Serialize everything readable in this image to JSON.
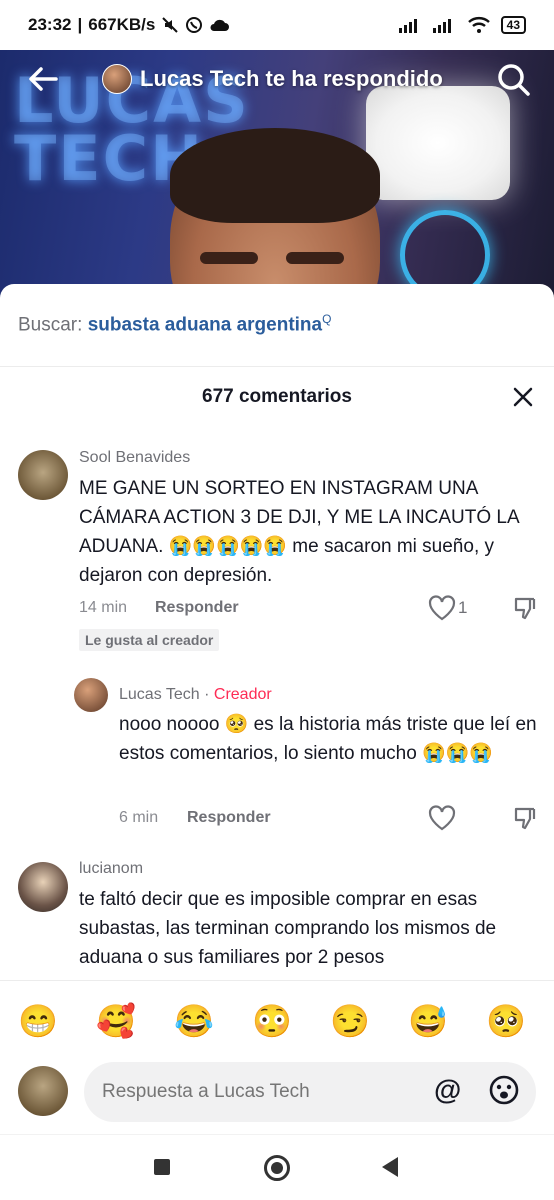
{
  "status_bar": {
    "time": "23:32",
    "net_speed": "667KB/s",
    "battery": "43"
  },
  "header": {
    "title": "Lucas Tech te ha respondido",
    "video_overlay_text": [
      "LUCAS",
      "TECH"
    ]
  },
  "search": {
    "prefix": "Buscar:",
    "query": "subasta aduana argentina",
    "mini_icon": "Q"
  },
  "comments_panel": {
    "count_label": "677 comentarios"
  },
  "comments": [
    {
      "author": "Sool Benavides",
      "text": "ME GANE UN SORTEO EN INSTAGRAM UNA CÁMARA ACTION 3 DE DJI, Y ME LA INCAUTÓ LA ADUANA. 😭😭😭😭😭 me sacaron mi sueño, y dejaron con depresión.",
      "time": "14 min",
      "reply_label": "Responder",
      "likes": "1",
      "creator_liked": "Le gusta al creador"
    },
    {
      "author": "Lucas Tech",
      "separator": "·",
      "badge": "Creador",
      "text": "nooo noooo 🥺 es la historia más triste que leí en estos comentarios, lo siento mucho 😭😭😭",
      "time": "6 min",
      "reply_label": "Responder"
    },
    {
      "author": "lucianom",
      "text": "te faltó decir que es imposible comprar en esas subastas, las terminan comprando los mismos de aduana o sus familiares por 2 pesos"
    }
  ],
  "emoji_bar": [
    "😁",
    "🥰",
    "😂",
    "😳",
    "😏",
    "😅",
    "🥺"
  ],
  "reply_input": {
    "placeholder": "Respuesta a Lucas Tech",
    "at_symbol": "@"
  },
  "colors": {
    "creator_badge": "#fe2c55",
    "search_query": "#2b5d9c",
    "secondary_text": "#6f7076"
  }
}
